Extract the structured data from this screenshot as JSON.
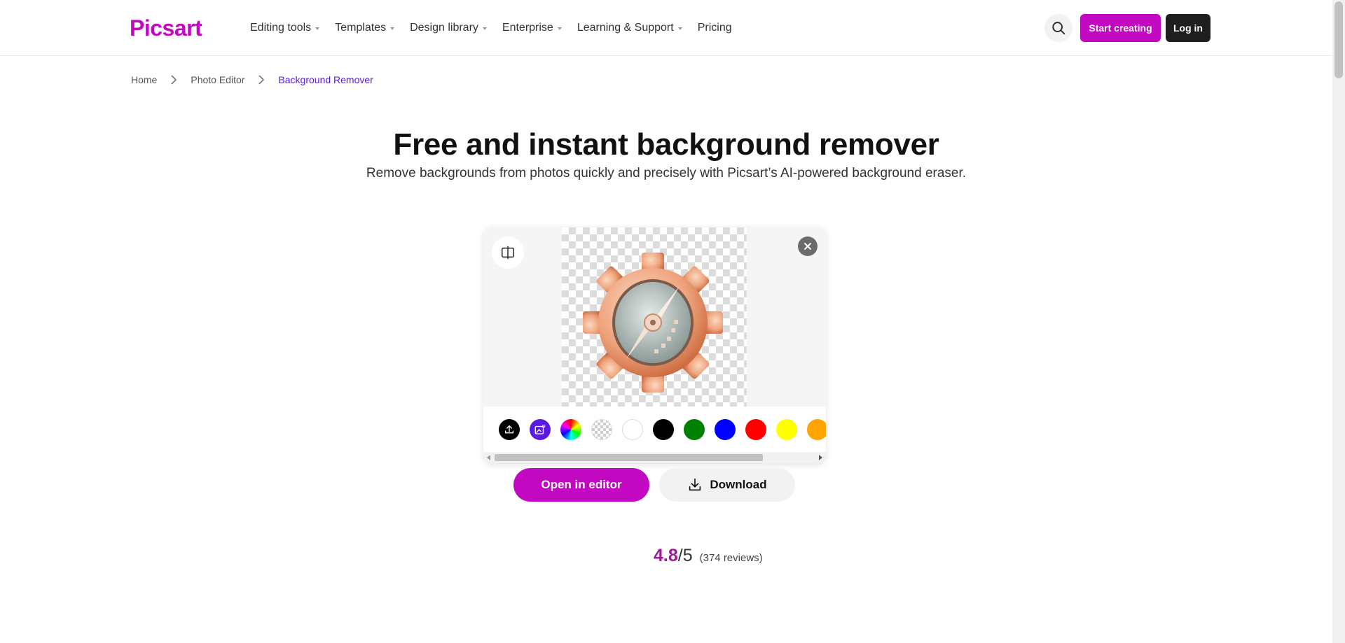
{
  "header": {
    "logo": "Picsart",
    "nav": [
      {
        "label": "Editing tools",
        "has_caret": true
      },
      {
        "label": "Templates",
        "has_caret": true
      },
      {
        "label": "Design library",
        "has_caret": true
      },
      {
        "label": "Enterprise",
        "has_caret": true
      },
      {
        "label": "Learning & Support",
        "has_caret": true
      },
      {
        "label": "Pricing",
        "has_caret": false
      }
    ],
    "search_icon": "search-icon",
    "start_label": "Start creating",
    "login_label": "Log in"
  },
  "breadcrumb": [
    {
      "label": "Home"
    },
    {
      "label": "Photo Editor"
    },
    {
      "label": "Background Remover"
    }
  ],
  "hero": {
    "title": "Free and instant background remover",
    "subtitle": "Remove backgrounds from photos quickly and precisely with Picsart’s AI-powered background eraser."
  },
  "widget": {
    "compare_icon": "compare-icon",
    "close_icon": "close-icon",
    "image": "gear-compass-3d-image",
    "swatches": [
      {
        "name": "upload",
        "icon": "upload-icon",
        "color": "#000000"
      },
      {
        "name": "ai-background",
        "icon": "ai-image-icon",
        "color": "#5a1ae0"
      },
      {
        "name": "color-picker",
        "icon": "color-wheel-icon",
        "color": "rainbow"
      },
      {
        "name": "transparent",
        "icon": "transparent-icon",
        "color": "transparent"
      },
      {
        "name": "white",
        "color": "#ffffff"
      },
      {
        "name": "black",
        "color": "#000000"
      },
      {
        "name": "green",
        "color": "#008000"
      },
      {
        "name": "blue",
        "color": "#0000ff"
      },
      {
        "name": "red",
        "color": "#ff0000"
      },
      {
        "name": "yellow",
        "color": "#ffff00"
      },
      {
        "name": "orange",
        "color": "#ffa500"
      }
    ]
  },
  "actions": {
    "open_label": "Open in editor",
    "download_label": "Download",
    "download_icon": "download-icon"
  },
  "rating": {
    "score": "4.8",
    "max": "/5",
    "count": "(374 reviews)"
  },
  "colors": {
    "brand": "#c209c1",
    "accent_purple": "#5a1ae0",
    "dark": "#1e1e1e"
  }
}
